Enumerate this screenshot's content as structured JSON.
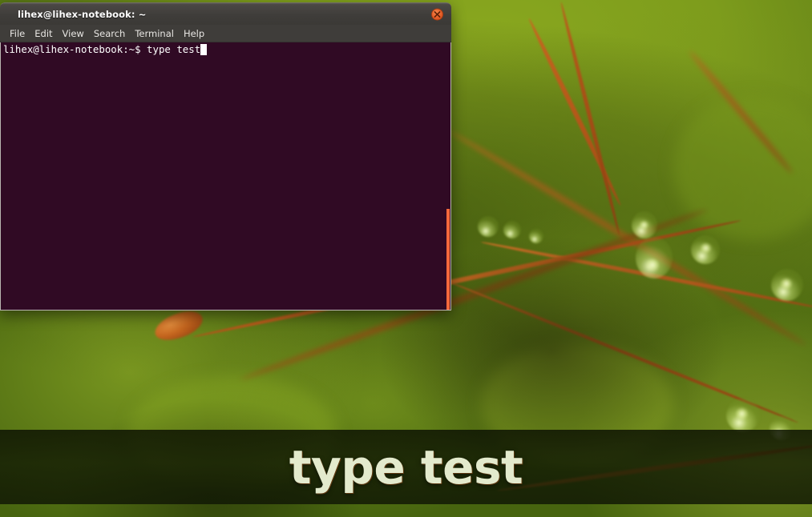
{
  "desktop": {
    "wallpaper_description": "macro photograph of moss with orange sporophyte stems and water droplets on blurred green background",
    "colors": {
      "wallpaper_green": "#7d9c1c",
      "wallpaper_dark_green": "#47640f",
      "stem_orange": "#b4551b",
      "accent_orange": "#f4693c"
    }
  },
  "terminal": {
    "title": "lihex@lihex-notebook: ~",
    "close_button_label": "Close",
    "close_icon": "close-x-icon",
    "menu": [
      {
        "label": "File"
      },
      {
        "label": "Edit"
      },
      {
        "label": "View"
      },
      {
        "label": "Search"
      },
      {
        "label": "Terminal"
      },
      {
        "label": "Help"
      }
    ],
    "prompt": "lihex@lihex-notebook:~$ ",
    "command": "type test",
    "cursor": "block-cursor",
    "colors": {
      "background": "#300a24",
      "text": "#ffffff",
      "titlebar": "#3f3d3a",
      "scrollbar": "#f4693c"
    }
  },
  "caption": {
    "text": "type test",
    "color": "#e3eacd"
  }
}
